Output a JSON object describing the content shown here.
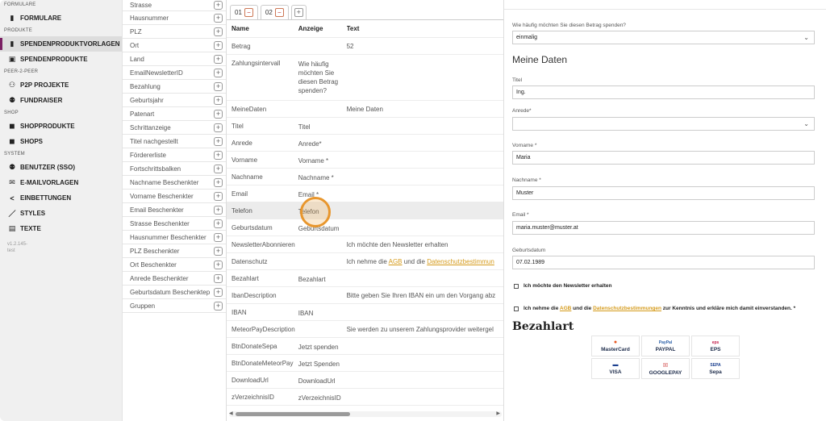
{
  "sidebar": {
    "sections": {
      "formulare": "FORMULARE",
      "produkte": "PRODUKTE",
      "peer2peer": "PEER-2-PEER",
      "shop": "SHOP",
      "system": "SYSTEM"
    },
    "items": {
      "formulare": "FORMULARE",
      "spendenproduktvorlagen": "SPENDENPRODUKTVORLAGEN",
      "spendenprodukte": "SPENDENPRODUKTE",
      "p2p_projekte": "P2P PROJEKTE",
      "fundraiser": "FUNDRAISER",
      "shopprodukte": "SHOPPRODUKTE",
      "shops": "SHOPS",
      "benutzer": "BENUTZER (SSO)",
      "emailvorlagen": "E-MAILVORLAGEN",
      "einbettungen": "EINBETTUNGEN",
      "styles": "STYLES",
      "texte": "TEXTE"
    },
    "version_line1": "v1.2.145-",
    "version_line2": "test"
  },
  "fieldlist": [
    "Strasse",
    "Hausnummer",
    "PLZ",
    "Ort",
    "Land",
    "EmailNewsletterID",
    "Bezahlung",
    "Geburtsjahr",
    "Patenart",
    "Schrittanzeige",
    "Titel nachgestellt",
    "Fördererliste",
    "Fortschrittsbalken",
    "Nachname Beschenkter",
    "Vorname Beschenkter",
    "Email Beschenkter",
    "Strasse Beschenkter",
    "Hausnummer Beschenkter",
    "PLZ Beschenkter",
    "Ort Beschenkter",
    "Anrede Beschenkter",
    "Geburtsdatum Beschenktер",
    "Gruppen"
  ],
  "tabs": {
    "tab1": "01",
    "tab2": "02",
    "close_symbol": "−",
    "add_symbol": "+"
  },
  "mapping": {
    "headers": {
      "name": "Name",
      "anzeige": "Anzeige",
      "text": "Text"
    },
    "rows": {
      "betrag": {
        "name": "Betrag",
        "anzeige": "",
        "text": "52"
      },
      "zahlungsintervall": {
        "name": "Zahlungsintervall",
        "anzeige": "Wie häufig möchten Sie diesen Betrag spenden?",
        "text": ""
      },
      "meinedaten": {
        "name": "MeineDaten",
        "anzeige": "",
        "text": "Meine Daten"
      },
      "titel": {
        "name": "Titel",
        "anzeige": "Titel",
        "text": ""
      },
      "anrede": {
        "name": "Anrede",
        "anzeige": "Anrede*",
        "text": ""
      },
      "vorname": {
        "name": "Vorname",
        "anzeige": "Vorname *",
        "text": ""
      },
      "nachname": {
        "name": "Nachname",
        "anzeige": "Nachname *",
        "text": ""
      },
      "email": {
        "name": "Email",
        "anzeige": "Email *",
        "text": ""
      },
      "telefon": {
        "name": "Telefon",
        "anzeige": "Telefon",
        "text": ""
      },
      "geburtsdatum": {
        "name": "Geburtsdatum",
        "anzeige": "Geburtsdatum",
        "text": ""
      },
      "newsletter": {
        "name": "NewsletterAbonnieren",
        "anzeige": "",
        "text": "Ich möchte den Newsletter erhalten"
      },
      "datenschutz": {
        "name": "Datenschutz",
        "anzeige": "",
        "text_pre": "Ich nehme die ",
        "text_agb": "AGB",
        "text_mid": " und die ",
        "text_ds": "Datenschutzbestimmun"
      },
      "bezahlart": {
        "name": "Bezahlart",
        "anzeige": "Bezahlart",
        "text": ""
      },
      "ibandesc": {
        "name": "IbanDescription",
        "anzeige": "",
        "text": "Bitte geben Sie Ihren IBAN ein um den Vorgang abz"
      },
      "iban": {
        "name": "IBAN",
        "anzeige": "IBAN",
        "text": ""
      },
      "meteordesc": {
        "name": "MeteorPayDescription",
        "anzeige": "",
        "text": "Sie werden zu unserem Zahlungsprovider weitergel"
      },
      "btnsepa": {
        "name": "BtnDonateSepa",
        "anzeige": "Jetzt spenden",
        "text": ""
      },
      "btnmeteor": {
        "name": "BtnDonateMeteorPay",
        "anzeige": "Jetzt Spenden",
        "text": ""
      },
      "download": {
        "name": "DownloadUrl",
        "anzeige": "DownloadUrl",
        "text": ""
      },
      "zverz": {
        "name": "zVerzeichnisID",
        "anzeige": "zVerzeichnisID",
        "text": ""
      }
    }
  },
  "preview": {
    "frequency_label": "Wie häufig möchten Sie diesen Betrag spenden?",
    "frequency_value": "einmalig",
    "meine_daten_heading": "Meine Daten",
    "titel_label": "Titel",
    "titel_value": "Ing.",
    "anrede_label": "Anrede*",
    "anrede_value": "",
    "vorname_label": "Vorname *",
    "vorname_value": "Maria",
    "nachname_label": "Nachname *",
    "nachname_value": "Muster",
    "email_label": "Email *",
    "email_value": "maria.muster@muster.at",
    "geburtsdatum_label": "Geburtsdatum",
    "geburtsdatum_value": "07.02.1989",
    "newsletter_text": "Ich möchte den Newsletter erhalten",
    "consent_pre": "Ich nehme die ",
    "consent_agb": "AGB",
    "consent_mid": " und die ",
    "consent_ds": "Datenschutzbestimmungen",
    "consent_post": " zur Kenntnis und erkläre mich damit einverstanden. *",
    "bezahlart_heading": "Bezahlart",
    "payment_methods": {
      "mastercard": "MasterCard",
      "paypal": "PAYPAL",
      "eps": "EPS",
      "visa": "VISA",
      "googlepay": "GOOGLEPAY",
      "sepa": "Sepa"
    }
  },
  "colors": {
    "accent": "#7a1f63",
    "link": "#d59b1c",
    "cursor_ring": "#e8962d"
  }
}
